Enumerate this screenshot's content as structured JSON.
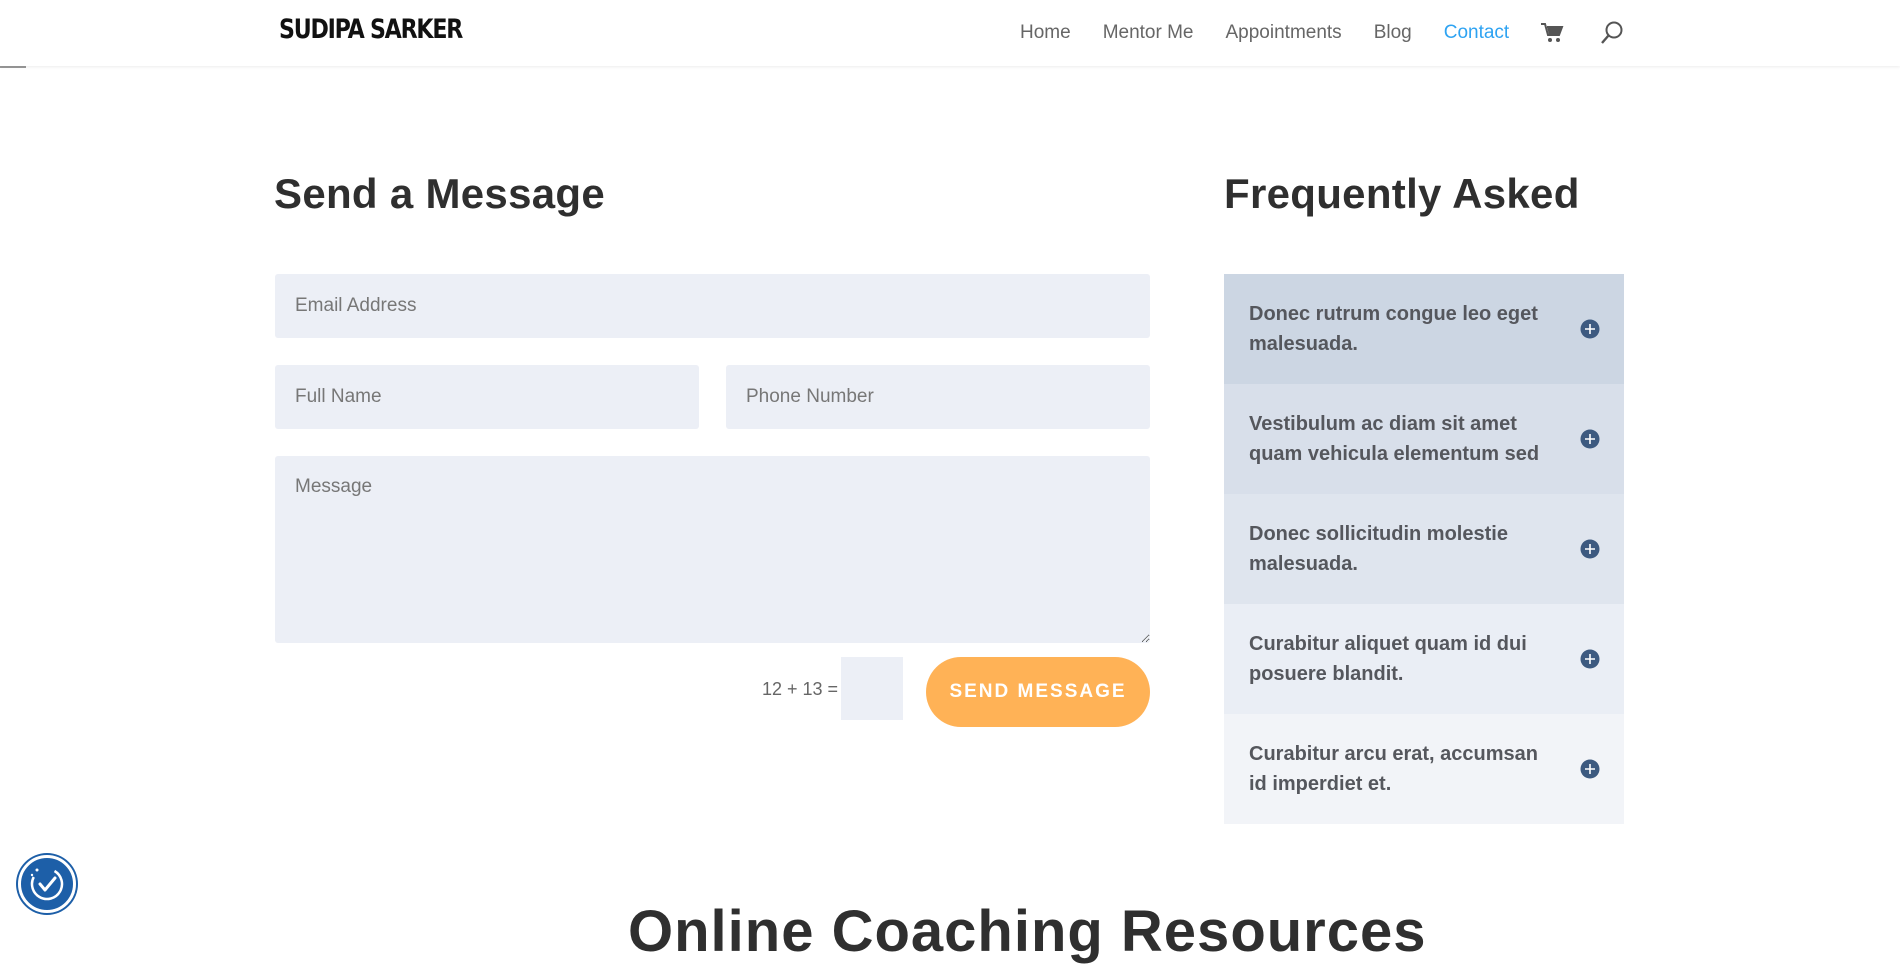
{
  "header": {
    "logo": "SUDIPA SARKER",
    "nav": [
      {
        "label": "Home",
        "active": false
      },
      {
        "label": "Mentor Me",
        "active": false
      },
      {
        "label": "Appointments",
        "active": false
      },
      {
        "label": "Blog",
        "active": false
      },
      {
        "label": "Contact",
        "active": true
      }
    ],
    "cart_icon": "cart-icon",
    "search_icon": "search-icon"
  },
  "contact_form": {
    "title": "Send a Message",
    "email_placeholder": "Email Address",
    "name_placeholder": "Full Name",
    "phone_placeholder": "Phone Number",
    "message_placeholder": "Message",
    "captcha_label": "12 + 13 =",
    "submit_label": "SEND MESSAGE"
  },
  "faq": {
    "title": "Frequently Asked",
    "items": [
      {
        "question": "Donec rutrum congue leo eget malesuada.",
        "bg": "#ccd6e3"
      },
      {
        "question": "Vestibulum ac diam sit amet quam vehicula elementum sed",
        "bg": "#d8dfea"
      },
      {
        "question": "Donec sollicitudin molestie malesuada.",
        "bg": "#dfe5ee"
      },
      {
        "question": "Curabitur aliquet quam id dui posuere blandit.",
        "bg": "#eaeef5"
      },
      {
        "question": "Curabitur arcu erat, accumsan id imperdiet et.",
        "bg": "#f2f4f8"
      }
    ]
  },
  "resources": {
    "title": "Online Coaching Resources"
  },
  "colors": {
    "accent": "#2ea3f2",
    "button": "#ffb256",
    "field_bg": "#eceff6",
    "plus_icon": "#3d5a80",
    "a11y": "#1d5fa8"
  }
}
